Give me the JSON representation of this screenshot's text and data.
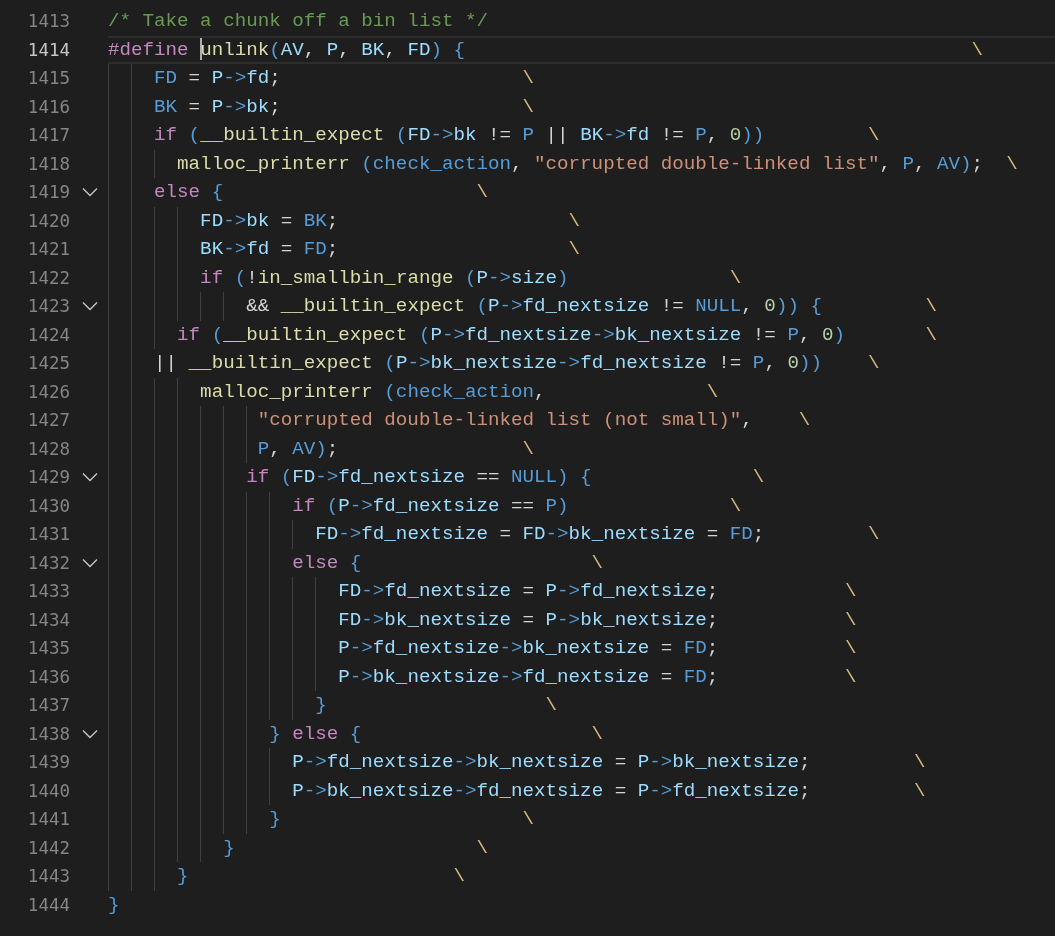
{
  "editor": {
    "lines": [
      {
        "number": "1413",
        "active": false,
        "tokens": [
          {
            "kind": "comment",
            "text": "/* Take a chunk off a bin list */"
          }
        ]
      },
      {
        "number": "1414",
        "active": true,
        "tokens": [
          {
            "kind": "keyword",
            "text": "#define "
          },
          {
            "kind": "function",
            "text": "unlink",
            "cursor": true
          },
          {
            "kind": "macro",
            "text": "("
          },
          {
            "kind": "variable",
            "text": "AV"
          },
          {
            "kind": "operator",
            "text": ", "
          },
          {
            "kind": "variable",
            "text": "P"
          },
          {
            "kind": "operator",
            "text": ", "
          },
          {
            "kind": "variable",
            "text": "BK"
          },
          {
            "kind": "operator",
            "text": ", "
          },
          {
            "kind": "variable",
            "text": "FD"
          },
          {
            "kind": "macro",
            "text": ") {"
          },
          {
            "kind": "continuation",
            "text": "                                            \\"
          }
        ]
      },
      {
        "number": "1415",
        "active": false,
        "tokens": [
          {
            "kind": "macro",
            "text": "    FD"
          },
          {
            "kind": "operator",
            "text": " = "
          },
          {
            "kind": "variable",
            "text": "P"
          },
          {
            "kind": "macro",
            "text": "->"
          },
          {
            "kind": "variable",
            "text": "fd"
          },
          {
            "kind": "operator",
            "text": ";"
          },
          {
            "kind": "continuation",
            "text": "                     \\"
          }
        ]
      },
      {
        "number": "1416",
        "active": false,
        "tokens": [
          {
            "kind": "macro",
            "text": "    BK"
          },
          {
            "kind": "operator",
            "text": " = "
          },
          {
            "kind": "variable",
            "text": "P"
          },
          {
            "kind": "macro",
            "text": "->"
          },
          {
            "kind": "variable",
            "text": "bk"
          },
          {
            "kind": "operator",
            "text": ";"
          },
          {
            "kind": "continuation",
            "text": "                     \\"
          }
        ]
      },
      {
        "number": "1417",
        "active": false,
        "tokens": [
          {
            "kind": "keyword",
            "text": "    if"
          },
          {
            "kind": "macro",
            "text": " ("
          },
          {
            "kind": "function",
            "text": "__builtin_expect"
          },
          {
            "kind": "macro",
            "text": " ("
          },
          {
            "kind": "variable",
            "text": "FD"
          },
          {
            "kind": "macro",
            "text": "->"
          },
          {
            "kind": "variable",
            "text": "bk"
          },
          {
            "kind": "operator",
            "text": " != "
          },
          {
            "kind": "macro",
            "text": "P"
          },
          {
            "kind": "operator",
            "text": " || "
          },
          {
            "kind": "variable",
            "text": "BK"
          },
          {
            "kind": "macro",
            "text": "->"
          },
          {
            "kind": "variable",
            "text": "fd"
          },
          {
            "kind": "operator",
            "text": " != "
          },
          {
            "kind": "macro",
            "text": "P"
          },
          {
            "kind": "operator",
            "text": ", "
          },
          {
            "kind": "number",
            "text": "0"
          },
          {
            "kind": "macro",
            "text": "))"
          },
          {
            "kind": "continuation",
            "text": "         \\"
          }
        ]
      },
      {
        "number": "1418",
        "active": false,
        "tokens": [
          {
            "kind": "function",
            "text": "      malloc_printerr"
          },
          {
            "kind": "macro",
            "text": " (check_action"
          },
          {
            "kind": "operator",
            "text": ", "
          },
          {
            "kind": "string",
            "text": "\"corrupted double-linked list\""
          },
          {
            "kind": "operator",
            "text": ", "
          },
          {
            "kind": "macro",
            "text": "P"
          },
          {
            "kind": "operator",
            "text": ", "
          },
          {
            "kind": "macro",
            "text": "AV)"
          },
          {
            "kind": "operator",
            "text": ";"
          },
          {
            "kind": "continuation",
            "text": "  \\"
          }
        ]
      },
      {
        "number": "1419",
        "active": false,
        "expanded": true,
        "tokens": [
          {
            "kind": "keyword",
            "text": "    else"
          },
          {
            "kind": "macro",
            "text": " {"
          },
          {
            "kind": "continuation",
            "text": "                      \\"
          }
        ]
      },
      {
        "number": "1420",
        "active": false,
        "tokens": [
          {
            "kind": "variable",
            "text": "        FD"
          },
          {
            "kind": "macro",
            "text": "->"
          },
          {
            "kind": "variable",
            "text": "bk"
          },
          {
            "kind": "operator",
            "text": " = "
          },
          {
            "kind": "macro",
            "text": "BK"
          },
          {
            "kind": "operator",
            "text": ";"
          },
          {
            "kind": "continuation",
            "text": "                    \\"
          }
        ]
      },
      {
        "number": "1421",
        "active": false,
        "tokens": [
          {
            "kind": "variable",
            "text": "        BK"
          },
          {
            "kind": "macro",
            "text": "->"
          },
          {
            "kind": "variable",
            "text": "fd"
          },
          {
            "kind": "operator",
            "text": " = "
          },
          {
            "kind": "macro",
            "text": "FD"
          },
          {
            "kind": "operator",
            "text": ";"
          },
          {
            "kind": "continuation",
            "text": "                    \\"
          }
        ]
      },
      {
        "number": "1422",
        "active": false,
        "tokens": [
          {
            "kind": "keyword",
            "text": "        if"
          },
          {
            "kind": "macro",
            "text": " ("
          },
          {
            "kind": "operator",
            "text": "!"
          },
          {
            "kind": "function",
            "text": "in_smallbin_range"
          },
          {
            "kind": "macro",
            "text": " ("
          },
          {
            "kind": "variable",
            "text": "P"
          },
          {
            "kind": "macro",
            "text": "->"
          },
          {
            "kind": "variable",
            "text": "size"
          },
          {
            "kind": "macro",
            "text": ")"
          },
          {
            "kind": "continuation",
            "text": "              \\"
          }
        ]
      },
      {
        "number": "1423",
        "active": false,
        "expanded": true,
        "tokens": [
          {
            "kind": "operator",
            "text": "            && "
          },
          {
            "kind": "function",
            "text": "__builtin_expect"
          },
          {
            "kind": "macro",
            "text": " ("
          },
          {
            "kind": "variable",
            "text": "P"
          },
          {
            "kind": "macro",
            "text": "->"
          },
          {
            "kind": "variable",
            "text": "fd_nextsize"
          },
          {
            "kind": "operator",
            "text": " != "
          },
          {
            "kind": "macro",
            "text": "NULL"
          },
          {
            "kind": "operator",
            "text": ", "
          },
          {
            "kind": "number",
            "text": "0"
          },
          {
            "kind": "macro",
            "text": ")) {"
          },
          {
            "kind": "continuation",
            "text": "         \\"
          }
        ]
      },
      {
        "number": "1424",
        "active": false,
        "tokens": [
          {
            "kind": "keyword",
            "text": "      if"
          },
          {
            "kind": "macro",
            "text": " ("
          },
          {
            "kind": "function",
            "text": "__builtin_expect"
          },
          {
            "kind": "macro",
            "text": " ("
          },
          {
            "kind": "variable",
            "text": "P"
          },
          {
            "kind": "macro",
            "text": "->"
          },
          {
            "kind": "variable",
            "text": "fd_nextsize"
          },
          {
            "kind": "macro",
            "text": "->"
          },
          {
            "kind": "variable",
            "text": "bk_nextsize"
          },
          {
            "kind": "operator",
            "text": " != "
          },
          {
            "kind": "macro",
            "text": "P"
          },
          {
            "kind": "operator",
            "text": ", "
          },
          {
            "kind": "number",
            "text": "0"
          },
          {
            "kind": "macro",
            "text": ")"
          },
          {
            "kind": "continuation",
            "text": "       \\"
          }
        ]
      },
      {
        "number": "1425",
        "active": false,
        "tokens": [
          {
            "kind": "operator",
            "text": "    || "
          },
          {
            "kind": "function",
            "text": "__builtin_expect"
          },
          {
            "kind": "macro",
            "text": " ("
          },
          {
            "kind": "variable",
            "text": "P"
          },
          {
            "kind": "macro",
            "text": "->"
          },
          {
            "kind": "variable",
            "text": "bk_nextsize"
          },
          {
            "kind": "macro",
            "text": "->"
          },
          {
            "kind": "variable",
            "text": "fd_nextsize"
          },
          {
            "kind": "operator",
            "text": " != "
          },
          {
            "kind": "macro",
            "text": "P"
          },
          {
            "kind": "operator",
            "text": ", "
          },
          {
            "kind": "number",
            "text": "0"
          },
          {
            "kind": "macro",
            "text": "))"
          },
          {
            "kind": "continuation",
            "text": "    \\"
          }
        ]
      },
      {
        "number": "1426",
        "active": false,
        "tokens": [
          {
            "kind": "function",
            "text": "        malloc_printerr"
          },
          {
            "kind": "macro",
            "text": " (check_action"
          },
          {
            "kind": "operator",
            "text": ","
          },
          {
            "kind": "continuation",
            "text": "              \\"
          }
        ]
      },
      {
        "number": "1427",
        "active": false,
        "tokens": [
          {
            "kind": "string",
            "text": "             \"corrupted double-linked list (not small)\""
          },
          {
            "kind": "operator",
            "text": ","
          },
          {
            "kind": "continuation",
            "text": "    \\"
          }
        ]
      },
      {
        "number": "1428",
        "active": false,
        "tokens": [
          {
            "kind": "macro",
            "text": "             P"
          },
          {
            "kind": "operator",
            "text": ", "
          },
          {
            "kind": "macro",
            "text": "AV)"
          },
          {
            "kind": "operator",
            "text": ";"
          },
          {
            "kind": "continuation",
            "text": "                \\"
          }
        ]
      },
      {
        "number": "1429",
        "active": false,
        "expanded": true,
        "tokens": [
          {
            "kind": "keyword",
            "text": "            if"
          },
          {
            "kind": "macro",
            "text": " ("
          },
          {
            "kind": "variable",
            "text": "FD"
          },
          {
            "kind": "macro",
            "text": "->"
          },
          {
            "kind": "variable",
            "text": "fd_nextsize"
          },
          {
            "kind": "operator",
            "text": " == "
          },
          {
            "kind": "macro",
            "text": "NULL) {"
          },
          {
            "kind": "continuation",
            "text": "              \\"
          }
        ]
      },
      {
        "number": "1430",
        "active": false,
        "tokens": [
          {
            "kind": "keyword",
            "text": "                if"
          },
          {
            "kind": "macro",
            "text": " ("
          },
          {
            "kind": "variable",
            "text": "P"
          },
          {
            "kind": "macro",
            "text": "->"
          },
          {
            "kind": "variable",
            "text": "fd_nextsize"
          },
          {
            "kind": "operator",
            "text": " == "
          },
          {
            "kind": "macro",
            "text": "P)"
          },
          {
            "kind": "continuation",
            "text": "              \\"
          }
        ]
      },
      {
        "number": "1431",
        "active": false,
        "tokens": [
          {
            "kind": "variable",
            "text": "                  FD"
          },
          {
            "kind": "macro",
            "text": "->"
          },
          {
            "kind": "variable",
            "text": "fd_nextsize"
          },
          {
            "kind": "operator",
            "text": " = "
          },
          {
            "kind": "variable",
            "text": "FD"
          },
          {
            "kind": "macro",
            "text": "->"
          },
          {
            "kind": "variable",
            "text": "bk_nextsize"
          },
          {
            "kind": "operator",
            "text": " = "
          },
          {
            "kind": "macro",
            "text": "FD"
          },
          {
            "kind": "operator",
            "text": ";"
          },
          {
            "kind": "continuation",
            "text": "         \\"
          }
        ]
      },
      {
        "number": "1432",
        "active": false,
        "expanded": true,
        "tokens": [
          {
            "kind": "keyword",
            "text": "                else"
          },
          {
            "kind": "macro",
            "text": " {"
          },
          {
            "kind": "continuation",
            "text": "                    \\"
          }
        ]
      },
      {
        "number": "1433",
        "active": false,
        "tokens": [
          {
            "kind": "variable",
            "text": "                    FD"
          },
          {
            "kind": "macro",
            "text": "->"
          },
          {
            "kind": "variable",
            "text": "fd_nextsize"
          },
          {
            "kind": "operator",
            "text": " = "
          },
          {
            "kind": "variable",
            "text": "P"
          },
          {
            "kind": "macro",
            "text": "->"
          },
          {
            "kind": "variable",
            "text": "fd_nextsize"
          },
          {
            "kind": "operator",
            "text": ";"
          },
          {
            "kind": "continuation",
            "text": "           \\"
          }
        ]
      },
      {
        "number": "1434",
        "active": false,
        "tokens": [
          {
            "kind": "variable",
            "text": "                    FD"
          },
          {
            "kind": "macro",
            "text": "->"
          },
          {
            "kind": "variable",
            "text": "bk_nextsize"
          },
          {
            "kind": "operator",
            "text": " = "
          },
          {
            "kind": "variable",
            "text": "P"
          },
          {
            "kind": "macro",
            "text": "->"
          },
          {
            "kind": "variable",
            "text": "bk_nextsize"
          },
          {
            "kind": "operator",
            "text": ";"
          },
          {
            "kind": "continuation",
            "text": "           \\"
          }
        ]
      },
      {
        "number": "1435",
        "active": false,
        "tokens": [
          {
            "kind": "variable",
            "text": "                    P"
          },
          {
            "kind": "macro",
            "text": "->"
          },
          {
            "kind": "variable",
            "text": "fd_nextsize"
          },
          {
            "kind": "macro",
            "text": "->"
          },
          {
            "kind": "variable",
            "text": "bk_nextsize"
          },
          {
            "kind": "operator",
            "text": " = "
          },
          {
            "kind": "macro",
            "text": "FD"
          },
          {
            "kind": "operator",
            "text": ";"
          },
          {
            "kind": "continuation",
            "text": "           \\"
          }
        ]
      },
      {
        "number": "1436",
        "active": false,
        "tokens": [
          {
            "kind": "variable",
            "text": "                    P"
          },
          {
            "kind": "macro",
            "text": "->"
          },
          {
            "kind": "variable",
            "text": "bk_nextsize"
          },
          {
            "kind": "macro",
            "text": "->"
          },
          {
            "kind": "variable",
            "text": "fd_nextsize"
          },
          {
            "kind": "operator",
            "text": " = "
          },
          {
            "kind": "macro",
            "text": "FD"
          },
          {
            "kind": "operator",
            "text": ";"
          },
          {
            "kind": "continuation",
            "text": "           \\"
          }
        ]
      },
      {
        "number": "1437",
        "active": false,
        "tokens": [
          {
            "kind": "macro",
            "text": "                  }"
          },
          {
            "kind": "continuation",
            "text": "                   \\"
          }
        ]
      },
      {
        "number": "1438",
        "active": false,
        "expanded": true,
        "tokens": [
          {
            "kind": "macro",
            "text": "              }"
          },
          {
            "kind": "keyword",
            "text": " else"
          },
          {
            "kind": "macro",
            "text": " {"
          },
          {
            "kind": "continuation",
            "text": "                    \\"
          }
        ]
      },
      {
        "number": "1439",
        "active": false,
        "tokens": [
          {
            "kind": "variable",
            "text": "                P"
          },
          {
            "kind": "macro",
            "text": "->"
          },
          {
            "kind": "variable",
            "text": "fd_nextsize"
          },
          {
            "kind": "macro",
            "text": "->"
          },
          {
            "kind": "variable",
            "text": "bk_nextsize"
          },
          {
            "kind": "operator",
            "text": " = "
          },
          {
            "kind": "variable",
            "text": "P"
          },
          {
            "kind": "macro",
            "text": "->"
          },
          {
            "kind": "variable",
            "text": "bk_nextsize"
          },
          {
            "kind": "operator",
            "text": ";"
          },
          {
            "kind": "continuation",
            "text": "         \\"
          }
        ]
      },
      {
        "number": "1440",
        "active": false,
        "tokens": [
          {
            "kind": "variable",
            "text": "                P"
          },
          {
            "kind": "macro",
            "text": "->"
          },
          {
            "kind": "variable",
            "text": "bk_nextsize"
          },
          {
            "kind": "macro",
            "text": "->"
          },
          {
            "kind": "variable",
            "text": "fd_nextsize"
          },
          {
            "kind": "operator",
            "text": " = "
          },
          {
            "kind": "variable",
            "text": "P"
          },
          {
            "kind": "macro",
            "text": "->"
          },
          {
            "kind": "variable",
            "text": "fd_nextsize"
          },
          {
            "kind": "operator",
            "text": ";"
          },
          {
            "kind": "continuation",
            "text": "         \\"
          }
        ]
      },
      {
        "number": "1441",
        "active": false,
        "tokens": [
          {
            "kind": "macro",
            "text": "              }"
          },
          {
            "kind": "continuation",
            "text": "                     \\"
          }
        ]
      },
      {
        "number": "1442",
        "active": false,
        "tokens": [
          {
            "kind": "macro",
            "text": "          }"
          },
          {
            "kind": "continuation",
            "text": "                     \\"
          }
        ]
      },
      {
        "number": "1443",
        "active": false,
        "tokens": [
          {
            "kind": "macro",
            "text": "      }"
          },
          {
            "kind": "continuation",
            "text": "                       \\"
          }
        ]
      },
      {
        "number": "1444",
        "active": false,
        "tokens": [
          {
            "kind": "macro",
            "text": "}"
          }
        ]
      }
    ]
  }
}
